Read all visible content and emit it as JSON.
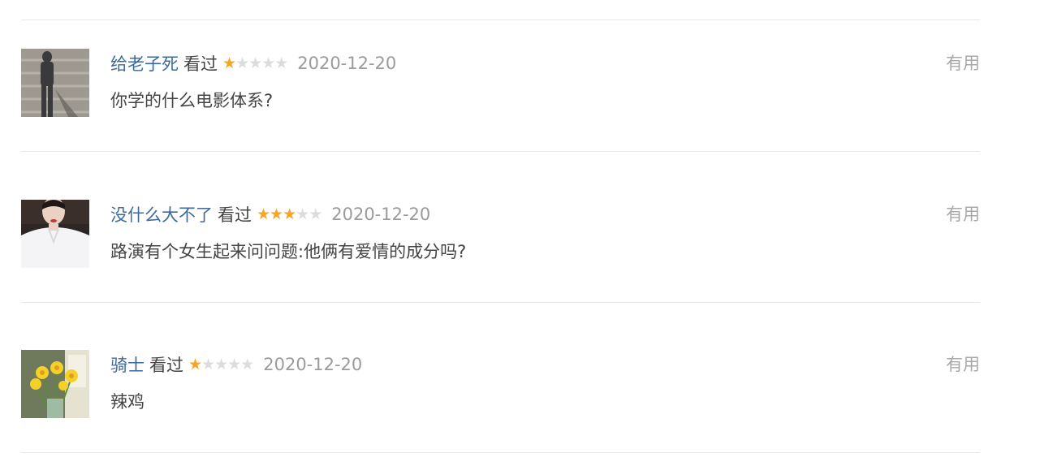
{
  "reviews": [
    {
      "user": "给老子死",
      "status": "看过",
      "rating": 1,
      "date": "2020-12-20",
      "useful_label": "有用",
      "content": "你学的什么电影体系?"
    },
    {
      "user": "没什么大不了",
      "status": "看过",
      "rating": 3,
      "date": "2020-12-20",
      "useful_label": "有用",
      "content": "路演有个女生起来问问题:他俩有爱情的成分吗?"
    },
    {
      "user": "骑士",
      "status": "看过",
      "rating": 1,
      "date": "2020-12-20",
      "useful_label": "有用",
      "content": "辣鸡"
    }
  ],
  "colors": {
    "username": "#3d6a9a",
    "star_on": "#f7a623",
    "star_off": "#dcdcdc",
    "date": "#9b9b9b"
  }
}
